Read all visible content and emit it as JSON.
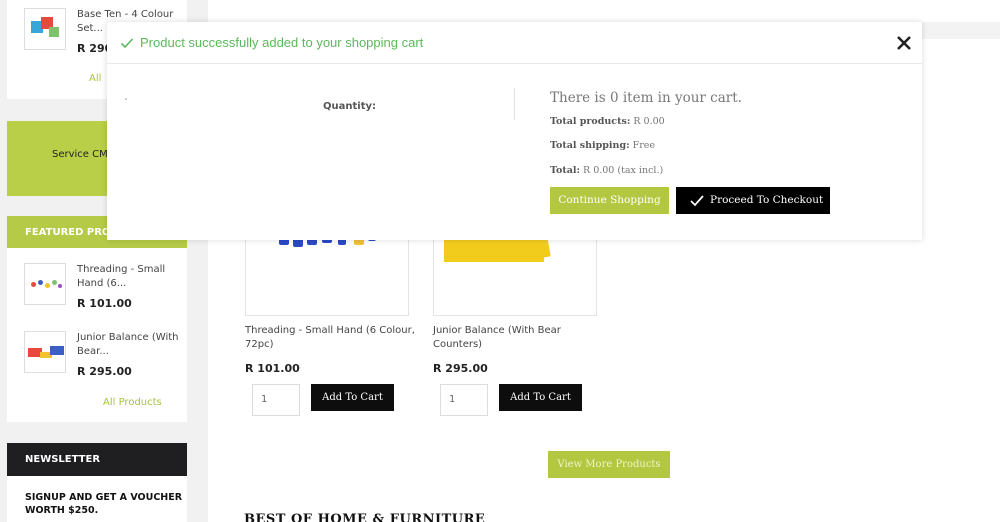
{
  "sidebar": {
    "top_product": {
      "name": "Base Ten - 4 Colour Set...",
      "price": "R 290"
    },
    "all_link_top": "All",
    "service_text": "Service CM",
    "featured_heading": "FEATURED PRO",
    "featured_products": [
      {
        "name": "Threading - Small Hand (6...",
        "price": "R 101.00"
      },
      {
        "name": "Junior Balance (With Bear...",
        "price": "R 295.00"
      }
    ],
    "all_products_link": "All Products",
    "newsletter_heading": "NEWSLETTER",
    "newsletter_text": "SIGNUP AND GET A VOUCHER WORTH $250."
  },
  "main": {
    "products": [
      {
        "title": "Threading - Small Hand (6 Colour, 72pc)",
        "price": "R 101.00",
        "qty": "1",
        "add_label": "Add To Cart"
      },
      {
        "title": "Junior Balance (With Bear Counters)",
        "price": "R 295.00",
        "qty": "1",
        "add_label": "Add To Cart"
      }
    ],
    "view_more_label": "View More Products",
    "section_title": "BEST OF HOME & FURNITURE"
  },
  "modal": {
    "title": "Product successfully added to your shopping cart",
    "quantity_label": "Quantity:",
    "cart_count_text": "There is 0 item in your cart.",
    "total_products_label": "Total products:",
    "total_products_value": "R 0.00",
    "total_shipping_label": "Total shipping:",
    "total_shipping_value": "Free",
    "total_label": "Total:",
    "total_value": "R 0.00 (tax incl.)",
    "continue_label": "Continue Shopping",
    "checkout_label": "Proceed To Checkout"
  },
  "colors": {
    "accent_green": "#b3c840",
    "success_green": "#5cb85c",
    "dark": "#000000"
  },
  "icons": {
    "success": "check-icon",
    "close": "close-icon",
    "checkout": "check-icon"
  }
}
